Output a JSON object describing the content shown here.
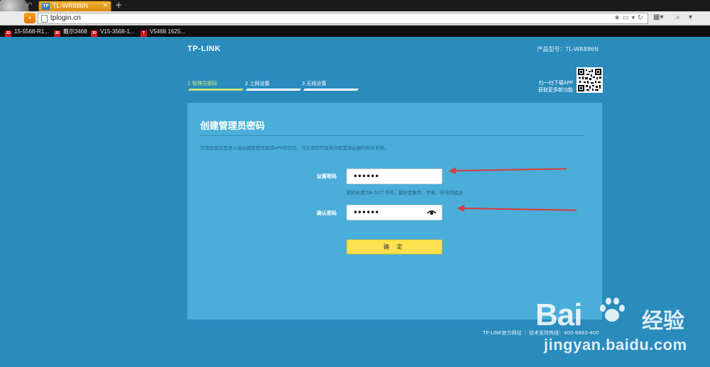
{
  "browser": {
    "tab_title": "TL-WR886N",
    "tab_favicon": "TP",
    "tab_close": "×",
    "new_tab": "+",
    "url": "tplogin.cn",
    "bookmarks": [
      {
        "label": "15-5568-R1...",
        "icon": "JD"
      },
      {
        "label": "戴尔3468",
        "icon": "JD"
      },
      {
        "label": "V15-3568-1...",
        "icon": "JD"
      },
      {
        "label": "V5468 1625...",
        "icon": "T"
      }
    ]
  },
  "header": {
    "brand": "TP-LINK",
    "model": "产品型号：TL-WR886N"
  },
  "steps": [
    {
      "label": "1 管理员密码",
      "active": true
    },
    {
      "label": "2 上网设置",
      "active": false
    },
    {
      "label": "3 无线设置",
      "active": false
    }
  ],
  "app_promo": {
    "line1": "扫一扫下载APP",
    "line2": "获取更多新功能"
  },
  "form": {
    "title": "创建管理员密码",
    "description": "管理员密码是进入路由器管理页面或APP的密码，凭此密码可查看并配置路由器的所有参数。",
    "password_label": "设置密码",
    "password_value": "••••••",
    "hint": "密码长度为6-32个字符，最好是数字、字母、符号的组合",
    "confirm_label": "确认密码",
    "confirm_value": "••••••",
    "submit_label": "确 定"
  },
  "footer": {
    "site_link": "TP-LINK官方网站",
    "support": "技术支持热线：400-8863-400"
  },
  "watermark": {
    "brand": "Bai",
    "brand_cn": "经验",
    "url": "jingyan.baidu.com"
  },
  "colors": {
    "page_bg": "#2a8bbd",
    "panel_bg": "#4aaed8",
    "step_active": "#c6e67a",
    "button": "#fde14f",
    "annotation_arrow": "#e03a3a"
  }
}
